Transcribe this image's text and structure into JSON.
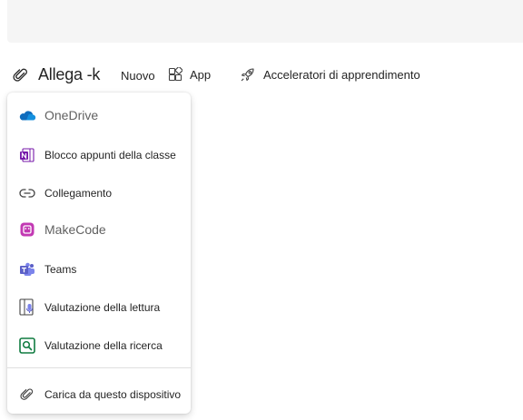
{
  "toolbar": {
    "attach_label": "Allega -k",
    "new_label": "Nuovo",
    "app_label": "App",
    "accelerators_label": "Acceleratori di apprendimento"
  },
  "menu": {
    "items": [
      {
        "label": "OneDrive",
        "icon": "onedrive-icon"
      },
      {
        "label": "Blocco appunti della classe",
        "icon": "onenote-icon"
      },
      {
        "label": "Collegamento",
        "icon": "link-icon"
      },
      {
        "label": "MakeCode",
        "icon": "makecode-icon"
      },
      {
        "label": "Teams",
        "icon": "teams-icon"
      },
      {
        "label": "Valutazione della lettura",
        "icon": "reading-progress-icon"
      },
      {
        "label": "Valutazione della ricerca",
        "icon": "search-progress-icon"
      },
      {
        "label": "Carica da questo dispositivo",
        "icon": "paperclip-icon"
      }
    ]
  },
  "colors": {
    "onedrive": "#0f6cbd",
    "onenote": "#7719aa",
    "makecode": "#c239b3",
    "teams": "#5b5fc7",
    "reading_progress": "#5b5fc7",
    "search_progress": "#107c41"
  }
}
